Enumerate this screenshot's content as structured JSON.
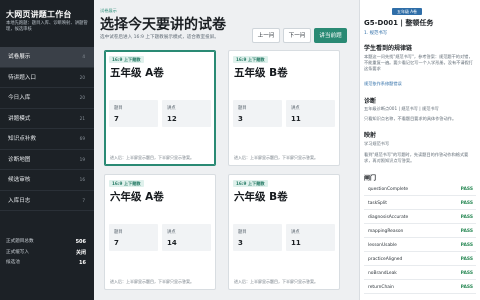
{
  "sidebar": {
    "title": "大网页讲题工作台",
    "subtitle": "本地先跑题：题目入库、诊断映射、讲题管理，候选审核",
    "nav": [
      {
        "label": "试卷展示",
        "count": "4"
      },
      {
        "label": "待讲题入口",
        "count": "20"
      },
      {
        "label": "今日入库",
        "count": "20"
      },
      {
        "label": "讲题模式",
        "count": "21"
      },
      {
        "label": "知识点补救",
        "count": "69"
      },
      {
        "label": "诊断地图",
        "count": "19"
      },
      {
        "label": "候选审核",
        "count": "16"
      },
      {
        "label": "入库日志",
        "count": "7"
      }
    ],
    "stats": [
      {
        "label": "正式题目总数",
        "value": "506"
      },
      {
        "label": "正式缓写入",
        "value": "关闭"
      },
      {
        "label": "候选池",
        "value": "16"
      }
    ]
  },
  "main": {
    "breadcrumb": "试卷展示",
    "title": "选择今天要讲的试卷",
    "description": "选中试卷后进入 16:9 上下题教展示模式，适合教室投屏。",
    "buttons": {
      "prev": "上一问",
      "next": "下一问",
      "go": "讲当前题"
    },
    "cards": [
      {
        "tag": "16:9 上下题教",
        "title": "五年级 A卷",
        "label_a": "题目",
        "value_a": "7",
        "label_b": "讲点",
        "value_b": "12",
        "footer": "进入后：上半屏显示题目，下半屏只显示答案。"
      },
      {
        "tag": "16:9 上下题教",
        "title": "五年级 B卷",
        "label_a": "题目",
        "value_a": "3",
        "label_b": "讲点",
        "value_b": "11",
        "footer": "进入后：上半屏显示题目，下半屏只显示答案。"
      },
      {
        "tag": "16:9 上下题教",
        "title": "六年级 A卷",
        "label_a": "题目",
        "value_a": "7",
        "label_b": "讲点",
        "value_b": "14",
        "footer": "进入后：上半屏显示题目，下半屏只显示答案。"
      },
      {
        "tag": "16:9 上下题教",
        "title": "六年级 B卷",
        "label_a": "题目",
        "value_a": "3",
        "label_b": "讲点",
        "value_b": "11",
        "footer": "进入后：上半屏显示题目，下半屏只显示答案。"
      }
    ]
  },
  "panel": {
    "tag": "五年级 A卷",
    "title": "G5-D001 | 整顿任务",
    "subtitle": "1. 规范书写",
    "sections": [
      {
        "heading": "学生看到的规律链",
        "text": "本题这一问先找\"规范书写\"，参考答案：规范题干的对错，不能重复一遍。要少看记忆写一个入学形册。没有不请假打这条要求"
      },
      {
        "heading": "",
        "text": "规范依作系修题错误",
        "blue": true
      },
      {
        "heading": "诊断",
        "text": "五年级诊断点001 | 规范书写 | 规范书写"
      },
      {
        "heading": "",
        "text": "只看知识点名称，不看题目要求的具体作答动作。"
      },
      {
        "heading": "映射",
        "text": "学习规范书写"
      },
      {
        "heading": "",
        "text": "看到\"规范书写\"的写题时，先读题目的作答动作和格式要求，再对照知识点写答案。"
      },
      {
        "heading": "闸门",
        "text": ""
      }
    ],
    "checks": [
      {
        "key": "questionComplete",
        "status": "PASS"
      },
      {
        "key": "taskSplit",
        "status": "PASS"
      },
      {
        "key": "diagnosisAccurate",
        "status": "PASS"
      },
      {
        "key": "mappingReason",
        "status": "PASS"
      },
      {
        "key": "lessonUsable",
        "status": "PASS"
      },
      {
        "key": "practiceAligned",
        "status": "PASS"
      },
      {
        "key": "noBrandLeak",
        "status": "PASS"
      },
      {
        "key": "returnChain",
        "status": "PASS"
      }
    ]
  }
}
